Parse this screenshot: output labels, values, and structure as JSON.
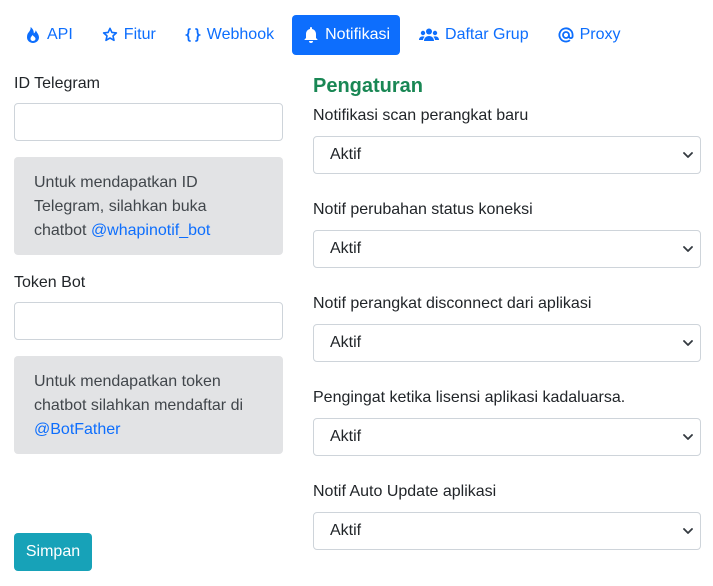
{
  "tabs": [
    {
      "label": "API",
      "icon": "fire-icon",
      "active": false
    },
    {
      "label": "Fitur",
      "icon": "star-icon",
      "active": false
    },
    {
      "label": "Webhook",
      "icon": "braces-icon",
      "active": false
    },
    {
      "label": "Notifikasi",
      "icon": "bell-icon",
      "active": true
    },
    {
      "label": "Daftar Grup",
      "icon": "users-icon",
      "active": false
    },
    {
      "label": "Proxy",
      "icon": "at-icon",
      "active": false
    }
  ],
  "left": {
    "telegram_id_label": "ID Telegram",
    "telegram_id_value": "",
    "telegram_info_text": "Untuk mendapatkan ID Telegram, silahkan buka chatbot",
    "telegram_info_link": "@whapinotif_bot",
    "token_label": "Token Bot",
    "token_value": "",
    "token_info_text": "Untuk mendapatkan token chatbot silahkan mendaftar di",
    "token_info_link": "@BotFather"
  },
  "settings": {
    "heading": "Pengaturan",
    "fields": [
      {
        "label": "Notifikasi scan perangkat baru",
        "value": "Aktif"
      },
      {
        "label": "Notif perubahan status koneksi",
        "value": "Aktif"
      },
      {
        "label": "Notif perangkat disconnect dari aplikasi",
        "value": "Aktif"
      },
      {
        "label": "Pengingat ketika lisensi aplikasi kadaluarsa.",
        "value": "Aktif"
      },
      {
        "label": "Notif Auto Update aplikasi",
        "value": "Aktif"
      }
    ]
  },
  "actions": {
    "save_label": "Simpan"
  },
  "colors": {
    "primary": "#0d6efd",
    "heading_green": "#198754",
    "save_button": "#17a2b8",
    "info_bg": "#e2e3e5"
  }
}
